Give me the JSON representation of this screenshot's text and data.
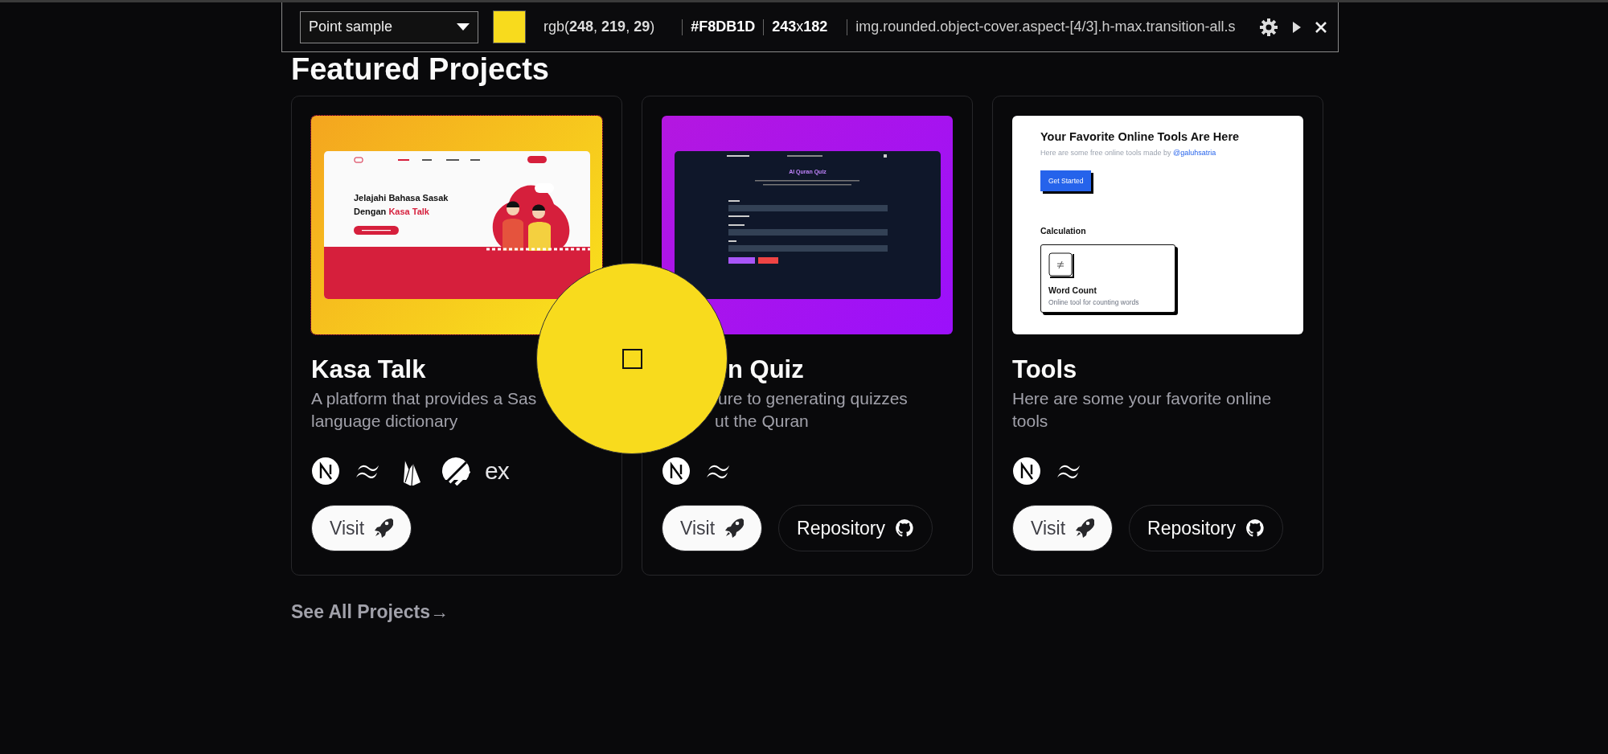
{
  "picker_toolbar": {
    "mode": "Point sample",
    "rgb": "rgb(**248**, **219**, **29**)",
    "hex": "#F8DB1D",
    "size": "**243**x**182**",
    "selector": "img.rounded.object-cover.aspect-[4/3].h-max.transition-all.s"
  },
  "section_title": "Featured Projects",
  "projects": [
    {
      "title": "Kasa Talk",
      "description_lines": [
        "A platform that provides a Sas",
        "language dictionary"
      ],
      "preview": {
        "kind": "kasa",
        "headline": "Jelajahi Bahasa Sasak",
        "headline_prefix": "Dengan",
        "headline_highlight": "Kasa Talk"
      },
      "stack": [
        {
          "kind": "n-circle"
        },
        {
          "kind": "wave"
        },
        {
          "kind": "flame"
        },
        {
          "kind": "slashed-circle"
        },
        {
          "kind": "text",
          "label": "ex"
        }
      ],
      "buttons": [
        {
          "kind": "visit",
          "label": "Visit"
        }
      ]
    },
    {
      "title": "n Quiz",
      "description_lines": [
        "ure to generating quizzes",
        "ut the Quran"
      ],
      "preview": {
        "kind": "quiz",
        "title": "Al Quran Quiz"
      },
      "stack": [
        {
          "kind": "n-circle"
        },
        {
          "kind": "wave"
        }
      ],
      "buttons": [
        {
          "kind": "visit",
          "label": "Visit"
        },
        {
          "kind": "repository",
          "label": "Repository"
        }
      ]
    },
    {
      "title": "Tools",
      "description_lines": [
        "Here are some your favorite online",
        "tools"
      ],
      "preview": {
        "kind": "tools",
        "title": "Your Favorite Online Tools Are Here",
        "subtitle": "Here are some free online tools made by",
        "link": "@galuhsatria",
        "button": "Get Started",
        "section": "Calculation",
        "tool_title": "Word Count",
        "tool_description": "Online tool for counting words"
      },
      "stack": [
        {
          "kind": "n-circle"
        },
        {
          "kind": "wave"
        }
      ],
      "buttons": [
        {
          "kind": "visit",
          "label": "Visit"
        },
        {
          "kind": "repository",
          "label": "Repository"
        }
      ]
    }
  ],
  "see_all_link": "See All Projects→"
}
